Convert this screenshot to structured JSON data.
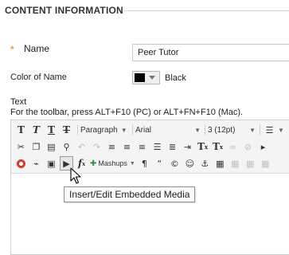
{
  "section": {
    "title": "CONTENT INFORMATION"
  },
  "name_field": {
    "required_mark": "*",
    "label": "Name",
    "value": "Peer Tutor"
  },
  "color_field": {
    "label": "Color of Name",
    "swatch_color": "#000000",
    "value": "Black"
  },
  "text_field": {
    "label": "Text",
    "hint": "For the toolbar, press ALT+F10 (PC) or ALT+FN+F10 (Mac)."
  },
  "toolbar": {
    "row1": {
      "bold": "T",
      "italic": "T",
      "underline": "T",
      "strikethrough": "T",
      "paragraph": "Paragraph",
      "font": "Arial",
      "size": "3 (12pt)"
    },
    "row2": {},
    "row3": {
      "mashups": "Mashups",
      "pilcrow": "¶",
      "quote": "“",
      "copyright": "©",
      "smiley": "☺",
      "anchor": "⚓"
    }
  },
  "tooltip": "Insert/Edit Embedded Media",
  "icons": {
    "bold": "bold-icon",
    "italic": "italic-icon",
    "underline": "underline-icon",
    "strikethrough": "strikethrough-icon",
    "cut": "cut-icon",
    "copy": "copy-icon",
    "paste": "paste-icon",
    "find": "search-icon",
    "undo": "undo-icon",
    "redo": "redo-icon",
    "align_left": "align-left-icon",
    "align_center": "align-center-icon",
    "align_right": "align-right-icon",
    "align_justify": "align-justify-icon",
    "insert_file": "insert-file-icon",
    "link": "link-icon",
    "embedded_media": "embedded-media-icon",
    "math": "math-formula-icon",
    "table": "table-icon"
  },
  "colors": {
    "required": "#e8a33d",
    "accent_red": "#d23b2e",
    "mashups_green": "#3a8d3a"
  }
}
